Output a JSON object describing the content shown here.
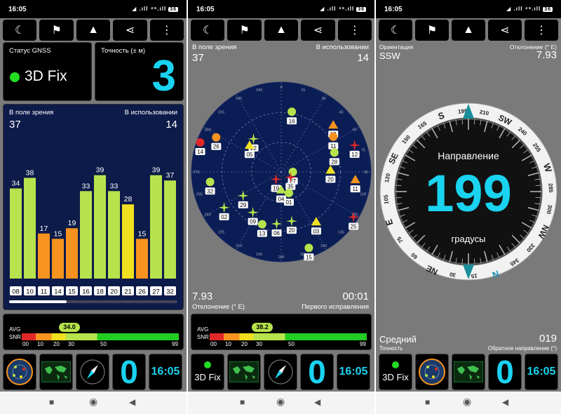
{
  "status_time": "16:05",
  "status_signal": "◢ .ıll ⁴⁶.ıll",
  "battery": "36",
  "toolbar_icons": [
    "moon-icon",
    "person-flag-icon",
    "navigation-arrow-icon",
    "share-icon",
    "more-vertical-icon"
  ],
  "toolbar_glyphs": [
    "☾",
    "⚑",
    "▲",
    "⋖",
    "⋮"
  ],
  "screen1": {
    "gnss_label": "Статус GNSS",
    "fix_text": "3D Fix",
    "accuracy_label": "Точность (± м)",
    "accuracy_value": "3",
    "in_view_label": "В поле зрения",
    "in_view_value": "37",
    "in_use_label": "В использовании",
    "in_use_value": "14",
    "bars": [
      {
        "id": "08",
        "snr": 34,
        "color": "#b7e34c"
      },
      {
        "id": "10",
        "snr": 38,
        "color": "#b7e34c"
      },
      {
        "id": "11",
        "snr": 17,
        "color": "#f7931e"
      },
      {
        "id": "14",
        "snr": 15,
        "color": "#f7931e"
      },
      {
        "id": "15",
        "snr": 19,
        "color": "#f7931e"
      },
      {
        "id": "16",
        "snr": 33,
        "color": "#b7e34c"
      },
      {
        "id": "18",
        "snr": 39,
        "color": "#b7e34c"
      },
      {
        "id": "20",
        "snr": 33,
        "color": "#b7e34c"
      },
      {
        "id": "21",
        "snr": 28,
        "color": "#f0e020"
      },
      {
        "id": "26",
        "snr": 15,
        "color": "#f7931e"
      },
      {
        "id": "27",
        "snr": 39,
        "color": "#b7e34c"
      },
      {
        "id": "32",
        "snr": 37,
        "color": "#b7e34c"
      }
    ],
    "avg_label": "AVG",
    "snr_label": "SNR",
    "avg_value": "34.0",
    "scale_ticks": [
      "00",
      "10",
      "20",
      "30",
      "50",
      "99"
    ]
  },
  "screen2": {
    "in_view_label": "В поле зрения",
    "in_view_value": "37",
    "in_use_label": "В использовании",
    "in_use_value": "14",
    "radar_ticks": [
      "240",
      "255",
      "270",
      "285",
      "300",
      "315",
      "330",
      "345",
      "0",
      "15",
      "30",
      "45",
      "60",
      "75",
      "90",
      "105",
      "120",
      "135",
      "150",
      "165",
      "180",
      "195",
      "210",
      "225"
    ],
    "satellites": [
      {
        "id": "26",
        "a": 298,
        "r": 0.82,
        "color": "#f7931e",
        "shape": "circle"
      },
      {
        "id": "16",
        "a": 10,
        "r": 0.68,
        "color": "#b7e34c",
        "shape": "circle"
      },
      {
        "id": "18",
        "a": 48,
        "r": 0.78,
        "color": "#f7931e",
        "shape": "tri"
      },
      {
        "id": "11",
        "a": 56,
        "r": 0.7,
        "color": "#f7931e",
        "shape": "circle"
      },
      {
        "id": "12",
        "a": 70,
        "r": 0.87,
        "color": "#e02828",
        "shape": "star"
      },
      {
        "id": "28",
        "a": 70,
        "r": 0.63,
        "color": "#b7e34c",
        "shape": "circle"
      },
      {
        "id": "20",
        "a": 88,
        "r": 0.55,
        "color": "#f0e020",
        "shape": "tri"
      },
      {
        "id": "11",
        "a": 96,
        "r": 0.83,
        "color": "#f7931e",
        "shape": "tri"
      },
      {
        "id": "22",
        "a": 320,
        "r": 0.48,
        "color": "#b7e34c",
        "shape": "star"
      },
      {
        "id": "05",
        "a": 310,
        "r": 0.46,
        "color": "#f0e020",
        "shape": "tri"
      },
      {
        "id": "14",
        "a": 290,
        "r": 0.96,
        "color": "#e02828",
        "shape": "circle"
      },
      {
        "id": "32",
        "a": 262,
        "r": 0.8,
        "color": "#b7e34c",
        "shape": "circle"
      },
      {
        "id": "27",
        "a": 90,
        "r": 0.13,
        "color": "#b7e34c",
        "shape": "circle"
      },
      {
        "id": "35",
        "a": 120,
        "r": 0.12,
        "color": "#e02828",
        "shape": "star"
      },
      {
        "id": "19",
        "a": 215,
        "r": 0.1,
        "color": "#e02828",
        "shape": "star"
      },
      {
        "id": "29",
        "a": 238,
        "r": 0.5,
        "color": "#b7e34c",
        "shape": "star"
      },
      {
        "id": "04",
        "a": 180,
        "r": 0.2,
        "color": "#b7e34c",
        "shape": "tri"
      },
      {
        "id": "01",
        "a": 160,
        "r": 0.25,
        "color": "#b7e34c",
        "shape": "circle"
      },
      {
        "id": "02",
        "a": 238,
        "r": 0.75,
        "color": "#b7e34c",
        "shape": "star"
      },
      {
        "id": "09",
        "a": 215,
        "r": 0.55,
        "color": "#b7e34c",
        "shape": "star"
      },
      {
        "id": "13",
        "a": 200,
        "r": 0.62,
        "color": "#b7e34c",
        "shape": "circle"
      },
      {
        "id": "06",
        "a": 185,
        "r": 0.58,
        "color": "#b7e34c",
        "shape": "star"
      },
      {
        "id": "20",
        "a": 168,
        "r": 0.56,
        "color": "#b7e34c",
        "shape": "star"
      },
      {
        "id": "03",
        "a": 145,
        "r": 0.68,
        "color": "#f0e020",
        "shape": "tri"
      },
      {
        "id": "15",
        "a": 160,
        "r": 0.9,
        "color": "#b7e34c",
        "shape": "circle"
      },
      {
        "id": "25",
        "a": 122,
        "r": 0.95,
        "color": "#e02828",
        "shape": "star"
      }
    ],
    "deviation_value": "7.93",
    "deviation_label": "Отклонение (° E)",
    "first_fix_value": "00:01",
    "first_fix_label": "Первого исправления",
    "avg_label": "AVG",
    "snr_label": "SNR",
    "avg_value": "38.2",
    "scale_ticks": [
      "00",
      "10",
      "20",
      "30",
      "50",
      "99"
    ]
  },
  "screen3": {
    "orientation_label": "Ориентация",
    "orientation_value": "SSW",
    "deviation_label": "Отклонение (° E)",
    "deviation_value": "7.93",
    "direction_label": "Направление",
    "heading_value": "199",
    "degrees_label": "градусы",
    "compass_labels": [
      "N",
      "15",
      "30",
      "NE",
      "60",
      "75",
      "E",
      "105",
      "120",
      "SE",
      "150",
      "165",
      "S",
      "195",
      "210",
      "SW",
      "240",
      "255",
      "W",
      "285",
      "300",
      "NW",
      "330",
      "345"
    ],
    "compass_rotation": -199,
    "accuracy_value": "Средний",
    "accuracy_label": "Точность",
    "reverse_value": "019",
    "reverse_label": "Обратное направление (°)"
  },
  "dock": {
    "fix_text": "3D Fix",
    "sat_count": "0",
    "clock": "16:05"
  },
  "colors": {
    "accent": "#19d3f0",
    "fix_green": "#22dd22",
    "panel_bg": "#000000",
    "chart_bg": "#0d1b4a",
    "radar_bg": "#0b1d55"
  }
}
